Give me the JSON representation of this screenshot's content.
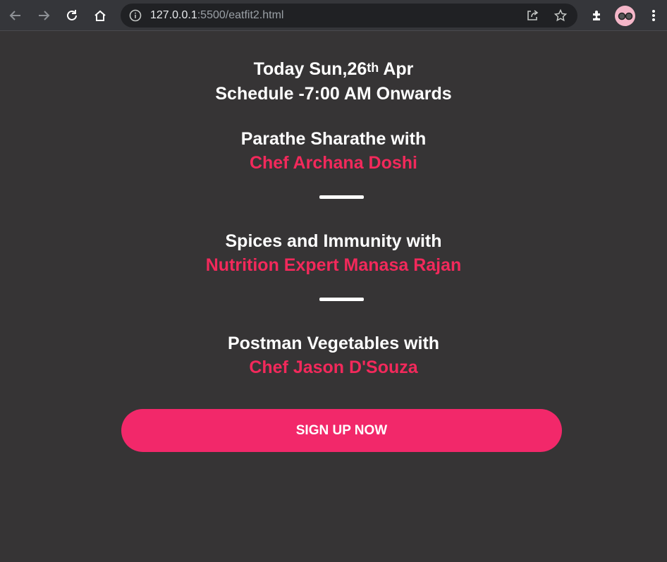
{
  "browser": {
    "url_host": "127.0.0.1",
    "url_path": ":5500/eatfit2.html",
    "icons": {
      "back": "back-arrow-icon",
      "forward": "forward-arrow-icon",
      "reload": "reload-icon",
      "home": "home-icon",
      "info": "info-icon",
      "share": "share-icon",
      "bookmark": "star-icon",
      "extensions": "puzzle-icon",
      "profile": "avatar",
      "menu": "kebab-menu-icon"
    }
  },
  "header": {
    "date_prefix": "Today Sun,26",
    "date_sup": "th",
    "date_suffix": " Apr",
    "schedule": "Schedule -7:00 AM Onwards"
  },
  "sessions": [
    {
      "title": "Parathe Sharathe with",
      "host": "Chef Archana Doshi"
    },
    {
      "title": "Spices and Immunity with",
      "host": "Nutrition Expert Manasa Rajan"
    },
    {
      "title": "Postman Vegetables with",
      "host": "Chef Jason D'Souza"
    }
  ],
  "cta": {
    "label": "SIGN UP NOW"
  },
  "colors": {
    "background": "#363435",
    "accent": "#f2295b",
    "button": "#f2286a",
    "text": "#ffffff"
  }
}
